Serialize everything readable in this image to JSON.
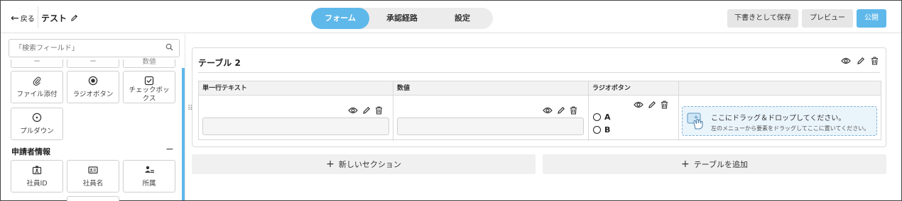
{
  "header": {
    "back_label": "戻る",
    "form_title": "テスト",
    "tabs": [
      {
        "label": "フォーム",
        "active": true
      },
      {
        "label": "承認経路",
        "active": false
      },
      {
        "label": "設定",
        "active": false
      }
    ],
    "save_draft_label": "下書きとして保存",
    "preview_label": "プレビュー",
    "publish_label": "公開"
  },
  "sidebar": {
    "search_placeholder": "「検索フィールド」",
    "cut_tiles": [
      "ー",
      "ー",
      "数値"
    ],
    "field_tiles": [
      {
        "label": "ファイル添付",
        "icon": "paperclip-icon"
      },
      {
        "label": "ラジオボタン",
        "icon": "radio-button-icon"
      },
      {
        "label": "チェックボックス",
        "icon": "checkbox-icon"
      },
      {
        "label": "プルダウン",
        "icon": "dropdown-icon"
      }
    ],
    "applicant_section": {
      "title": "申請者情報",
      "toggle": "−",
      "tiles": [
        {
          "label": "社員ID",
          "icon": "employee-id-icon"
        },
        {
          "label": "社員名",
          "icon": "name-card-icon"
        },
        {
          "label": "所属",
          "icon": "department-icon"
        }
      ]
    }
  },
  "main": {
    "table_card": {
      "title": "テーブル 2",
      "columns": [
        {
          "header": "単一行テキスト"
        },
        {
          "header": "数値"
        },
        {
          "header": "ラジオボタン",
          "options": [
            "A",
            "B"
          ]
        }
      ],
      "dropzone": {
        "title": "ここにドラッグ＆ドロップしてください。",
        "hint": "左のメニューから要素をドラッグしてここに置いてください。"
      }
    },
    "new_section_label": "新しいセクション",
    "add_table_label": "テーブルを追加"
  },
  "colors": {
    "accent": "#5fb8ea",
    "button_gray": "#e6e6e6",
    "dropzone_bg": "#eaf4fb"
  }
}
